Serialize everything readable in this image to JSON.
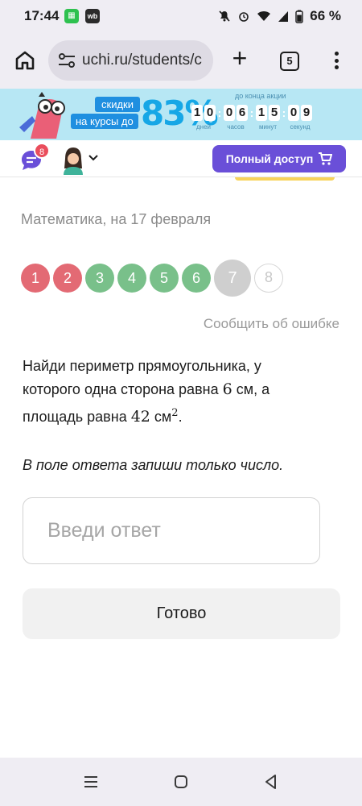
{
  "status_bar": {
    "time": "17:44",
    "battery": "66 %",
    "icons": [
      "mute-icon",
      "alarm-icon",
      "wifi-icon",
      "signal-icon",
      "battery-icon"
    ]
  },
  "browser": {
    "url": "uchi.ru/students/c",
    "tab_count": "5"
  },
  "promo": {
    "line1": "скидки",
    "line2": "на курсы до",
    "discount": "83%",
    "countdown_caption": "до конца акции",
    "countdown": [
      {
        "digits": [
          "1",
          "0"
        ],
        "label": "дней"
      },
      {
        "digits": [
          "0",
          "6"
        ],
        "label": "часов"
      },
      {
        "digits": [
          "1",
          "5"
        ],
        "label": "минут"
      },
      {
        "digits": [
          "0",
          "9"
        ],
        "label": "секунд"
      }
    ]
  },
  "header": {
    "chat_badge": "8",
    "full_access_label": "Полный доступ"
  },
  "task": {
    "lesson_title": "Математика, на 17 февраля",
    "steps": [
      {
        "label": "1",
        "state": "wrong"
      },
      {
        "label": "2",
        "state": "wrong"
      },
      {
        "label": "3",
        "state": "right"
      },
      {
        "label": "4",
        "state": "right"
      },
      {
        "label": "5",
        "state": "right"
      },
      {
        "label": "6",
        "state": "right"
      },
      {
        "label": "7",
        "state": "current"
      },
      {
        "label": "8",
        "state": "todo"
      }
    ],
    "report_error": "Сообщить об ошибке",
    "question_part1": "Найди периметр прямоугольника, у которого одна сторона равна",
    "side": "6",
    "question_part2": "см, а площадь равна",
    "area": "42",
    "unit": "см",
    "power": "2",
    "question_end": ".",
    "instruction": "В поле ответа запиши только число.",
    "answer_placeholder": "Введи ответ",
    "answer_value": "",
    "done_label": "Готово"
  },
  "colors": {
    "accent": "#6a4fd8",
    "wrong": "#e36a74",
    "right": "#79c08a",
    "current": "#cfcfcf",
    "promo_bg": "#b7e7f4"
  }
}
